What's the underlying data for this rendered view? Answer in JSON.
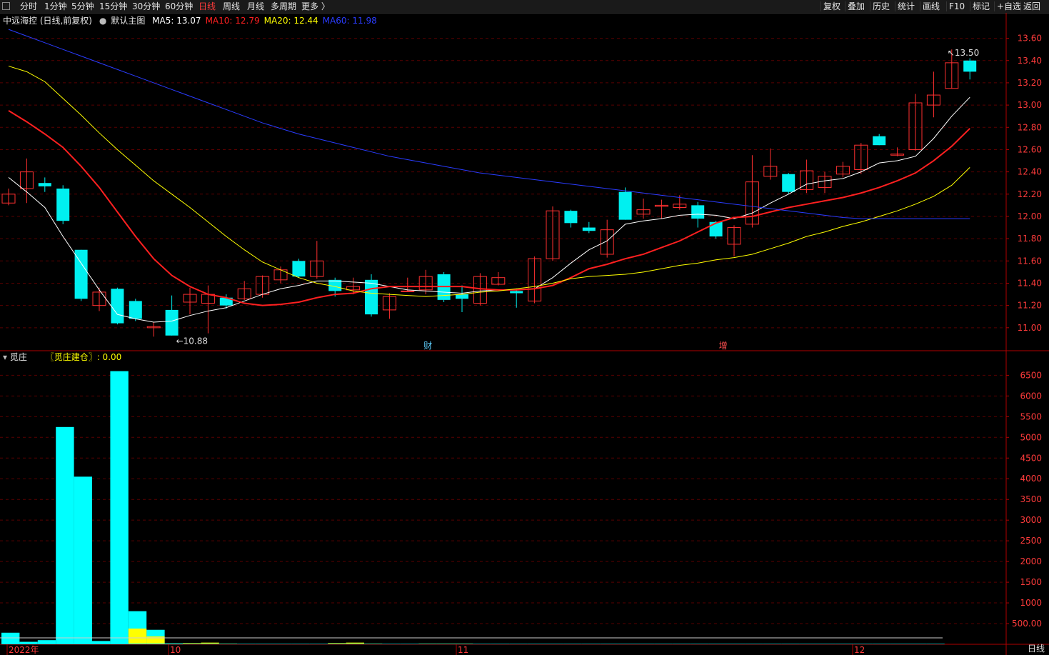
{
  "topbar": {
    "periods": [
      "分时",
      "1分钟",
      "5分钟",
      "15分钟",
      "30分钟",
      "60分钟",
      "日线",
      "周线",
      "月线",
      "多周期",
      "更多 〉"
    ],
    "active_period": "日线",
    "tools": [
      "复权",
      "叠加",
      "历史",
      "统计",
      "画线",
      "F10",
      "标记",
      "+自选",
      "返回"
    ]
  },
  "main_legend": {
    "stock_name": "中远海控 (日线,前复权)",
    "template": "默认主图",
    "ma": [
      {
        "label": "MA5: 13.07",
        "color": "#ffffff"
      },
      {
        "label": "MA10: 12.79",
        "color": "#ff2020"
      },
      {
        "label": "MA20: 12.44",
        "color": "#ffff00"
      },
      {
        "label": "MA60: 11.98",
        "color": "#2a3cff"
      }
    ]
  },
  "sub_legend": {
    "name": "觅庄",
    "indicator": "〖觅庄建仓〗: 0.00"
  },
  "markers": {
    "low_label": "10.88",
    "high_label": "13.50",
    "event_cai": "财",
    "event_zeng": "增"
  },
  "xaxis_labels": [
    {
      "label": "2022年",
      "color": "#ff3b3b"
    },
    {
      "label": "10",
      "color": "#ff3b3b"
    },
    {
      "label": "11",
      "color": "#ff3b3b"
    },
    {
      "label": "12",
      "color": "#ff3b3b"
    }
  ],
  "bottom_right_label": "日线",
  "colors": {
    "up": "#ff3030",
    "down": "#00f0f0",
    "grid": "#5a0000",
    "axis": "#b00000",
    "ma5": "#ffffff",
    "ma10": "#ff2020",
    "ma20": "#ffff00",
    "ma60": "#2a3cff",
    "vol_yellow": "#ffff00",
    "vol_cyan": "#00ffff"
  },
  "chart_data": [
    {
      "type": "candlestick",
      "title": "中远海控 (日线,前复权)",
      "ylim": [
        10.8,
        13.7
      ],
      "yticks": [
        "13.60",
        "13.40",
        "13.20",
        "13.00",
        "12.80",
        "12.60",
        "12.40",
        "12.20",
        "12.00",
        "11.80",
        "11.60",
        "11.40",
        "11.20",
        "11.00"
      ],
      "candles": [
        {
          "o": 12.12,
          "h": 12.25,
          "l": 12.1,
          "c": 12.2
        },
        {
          "o": 12.25,
          "h": 12.52,
          "l": 12.12,
          "c": 12.4
        },
        {
          "o": 12.3,
          "h": 12.35,
          "l": 12.22,
          "c": 12.27
        },
        {
          "o": 12.25,
          "h": 12.28,
          "l": 11.93,
          "c": 11.96
        },
        {
          "o": 11.7,
          "h": 11.7,
          "l": 11.24,
          "c": 11.26
        },
        {
          "o": 11.2,
          "h": 11.36,
          "l": 11.15,
          "c": 11.32
        },
        {
          "o": 11.35,
          "h": 11.36,
          "l": 11.03,
          "c": 11.04
        },
        {
          "o": 11.24,
          "h": 11.26,
          "l": 11.06,
          "c": 11.08
        },
        {
          "o": 11.0,
          "h": 11.05,
          "l": 10.92,
          "c": 11.01
        },
        {
          "o": 11.16,
          "h": 11.29,
          "l": 10.93,
          "c": 10.93
        },
        {
          "o": 11.23,
          "h": 11.36,
          "l": 11.12,
          "c": 11.3
        },
        {
          "o": 11.22,
          "h": 11.38,
          "l": 10.95,
          "c": 11.3
        },
        {
          "o": 11.27,
          "h": 11.3,
          "l": 11.17,
          "c": 11.2
        },
        {
          "o": 11.26,
          "h": 11.42,
          "l": 11.25,
          "c": 11.35
        },
        {
          "o": 11.3,
          "h": 11.47,
          "l": 11.27,
          "c": 11.46
        },
        {
          "o": 11.43,
          "h": 11.55,
          "l": 11.4,
          "c": 11.52
        },
        {
          "o": 11.6,
          "h": 11.62,
          "l": 11.45,
          "c": 11.46
        },
        {
          "o": 11.46,
          "h": 11.78,
          "l": 11.44,
          "c": 11.6
        },
        {
          "o": 11.43,
          "h": 11.45,
          "l": 11.28,
          "c": 11.33
        },
        {
          "o": 11.34,
          "h": 11.45,
          "l": 11.3,
          "c": 11.37
        },
        {
          "o": 11.43,
          "h": 11.48,
          "l": 11.1,
          "c": 11.12
        },
        {
          "o": 11.16,
          "h": 11.31,
          "l": 11.08,
          "c": 11.28
        },
        {
          "o": 11.33,
          "h": 11.45,
          "l": 11.32,
          "c": 11.33
        },
        {
          "o": 11.34,
          "h": 11.52,
          "l": 11.3,
          "c": 11.46
        },
        {
          "o": 11.48,
          "h": 11.5,
          "l": 11.23,
          "c": 11.25
        },
        {
          "o": 11.3,
          "h": 11.38,
          "l": 11.14,
          "c": 11.26
        },
        {
          "o": 11.22,
          "h": 11.49,
          "l": 11.2,
          "c": 11.46
        },
        {
          "o": 11.39,
          "h": 11.5,
          "l": 11.38,
          "c": 11.45
        },
        {
          "o": 11.33,
          "h": 11.35,
          "l": 11.18,
          "c": 11.31
        },
        {
          "o": 11.24,
          "h": 11.64,
          "l": 11.22,
          "c": 11.62
        },
        {
          "o": 11.62,
          "h": 12.09,
          "l": 11.6,
          "c": 12.05
        },
        {
          "o": 12.05,
          "h": 12.06,
          "l": 11.9,
          "c": 11.94
        },
        {
          "o": 11.9,
          "h": 11.95,
          "l": 11.85,
          "c": 11.87
        },
        {
          "o": 11.66,
          "h": 11.97,
          "l": 11.63,
          "c": 11.88
        },
        {
          "o": 12.22,
          "h": 12.26,
          "l": 11.97,
          "c": 11.97
        },
        {
          "o": 12.02,
          "h": 12.16,
          "l": 11.98,
          "c": 12.06
        },
        {
          "o": 12.09,
          "h": 12.15,
          "l": 11.98,
          "c": 12.1
        },
        {
          "o": 12.08,
          "h": 12.19,
          "l": 12.06,
          "c": 12.11
        },
        {
          "o": 12.1,
          "h": 12.13,
          "l": 11.9,
          "c": 11.98
        },
        {
          "o": 11.95,
          "h": 11.96,
          "l": 11.8,
          "c": 11.82
        },
        {
          "o": 11.75,
          "h": 11.92,
          "l": 11.64,
          "c": 11.9
        },
        {
          "o": 11.93,
          "h": 12.55,
          "l": 11.9,
          "c": 12.31
        },
        {
          "o": 12.36,
          "h": 12.61,
          "l": 12.33,
          "c": 12.45
        },
        {
          "o": 12.38,
          "h": 12.39,
          "l": 12.2,
          "c": 12.22
        },
        {
          "o": 12.24,
          "h": 12.51,
          "l": 12.21,
          "c": 12.41
        },
        {
          "o": 12.26,
          "h": 12.4,
          "l": 12.21,
          "c": 12.36
        },
        {
          "o": 12.38,
          "h": 12.49,
          "l": 12.35,
          "c": 12.45
        },
        {
          "o": 12.42,
          "h": 12.66,
          "l": 12.38,
          "c": 12.64
        },
        {
          "o": 12.72,
          "h": 12.74,
          "l": 12.64,
          "c": 12.64
        },
        {
          "o": 12.55,
          "h": 12.62,
          "l": 12.54,
          "c": 12.56
        },
        {
          "o": 12.6,
          "h": 13.1,
          "l": 12.59,
          "c": 13.02
        },
        {
          "o": 13.0,
          "h": 13.3,
          "l": 12.89,
          "c": 13.09
        },
        {
          "o": 13.15,
          "h": 13.5,
          "l": 13.15,
          "c": 13.38
        },
        {
          "o": 13.4,
          "h": 13.42,
          "l": 13.23,
          "c": 13.3
        }
      ],
      "series": [
        {
          "name": "MA5",
          "values": [
            12.35,
            12.22,
            12.08,
            11.82,
            11.58,
            11.34,
            11.12,
            11.08,
            11.05,
            11.06,
            11.11,
            11.15,
            11.18,
            11.24,
            11.3,
            11.35,
            11.38,
            11.42,
            11.42,
            11.41,
            11.4,
            11.37,
            11.34,
            11.33,
            11.32,
            11.31,
            11.33,
            11.34,
            11.34,
            11.35,
            11.45,
            11.58,
            11.7,
            11.78,
            11.93,
            11.96,
            11.98,
            12.01,
            12.02,
            12.01,
            11.98,
            12.03,
            12.12,
            12.2,
            12.29,
            12.32,
            12.34,
            12.4,
            12.48,
            12.5,
            12.54,
            12.7,
            12.9,
            13.07
          ]
        },
        {
          "name": "MA10",
          "values": [
            12.95,
            12.85,
            12.74,
            12.62,
            12.45,
            12.26,
            12.04,
            11.82,
            11.62,
            11.47,
            11.37,
            11.3,
            11.27,
            11.22,
            11.2,
            11.21,
            11.23,
            11.27,
            11.3,
            11.31,
            11.35,
            11.37,
            11.37,
            11.37,
            11.37,
            11.37,
            11.35,
            11.34,
            11.34,
            11.35,
            11.38,
            11.45,
            11.53,
            11.57,
            11.62,
            11.66,
            11.72,
            11.78,
            11.86,
            11.94,
            11.99,
            12.0,
            12.04,
            12.08,
            12.11,
            12.14,
            12.17,
            12.21,
            12.26,
            12.32,
            12.39,
            12.5,
            12.63,
            12.79
          ]
        },
        {
          "name": "MA20",
          "values": [
            13.35,
            13.3,
            13.21,
            13.06,
            12.91,
            12.75,
            12.6,
            12.46,
            12.32,
            12.2,
            12.08,
            11.95,
            11.82,
            11.7,
            11.59,
            11.52,
            11.45,
            11.4,
            11.37,
            11.33,
            11.31,
            11.3,
            11.29,
            11.28,
            11.29,
            11.3,
            11.32,
            11.33,
            11.35,
            11.37,
            11.4,
            11.44,
            11.46,
            11.47,
            11.48,
            11.5,
            11.53,
            11.56,
            11.58,
            11.61,
            11.63,
            11.66,
            11.71,
            11.76,
            11.82,
            11.86,
            11.91,
            11.95,
            12.0,
            12.05,
            12.11,
            12.18,
            12.28,
            12.44
          ]
        },
        {
          "name": "MA60",
          "values": [
            13.68,
            13.62,
            13.56,
            13.5,
            13.44,
            13.38,
            13.32,
            13.26,
            13.2,
            13.14,
            13.08,
            13.02,
            12.96,
            12.9,
            12.84,
            12.79,
            12.74,
            12.7,
            12.66,
            12.62,
            12.58,
            12.54,
            12.51,
            12.48,
            12.45,
            12.42,
            12.39,
            12.37,
            12.35,
            12.33,
            12.31,
            12.29,
            12.27,
            12.25,
            12.23,
            12.21,
            12.19,
            12.17,
            12.15,
            12.13,
            12.11,
            12.09,
            12.07,
            12.05,
            12.03,
            12.01,
            11.99,
            11.98,
            11.98,
            11.98,
            11.98,
            11.98,
            11.98,
            11.98
          ]
        }
      ]
    },
    {
      "type": "bar",
      "title": "觅庄",
      "ylim": [
        0,
        6800
      ],
      "yticks": [
        "6500",
        "6000",
        "5500",
        "5000",
        "4500",
        "4000",
        "3500",
        "3000",
        "2500",
        "2000",
        "1500",
        "1000",
        "500.00"
      ],
      "series": [
        {
          "name": "cyan",
          "values": [
            280,
            60,
            100,
            5250,
            4050,
            80,
            6600,
            800,
            350,
            20,
            10,
            10,
            10,
            10,
            10,
            10,
            10,
            10,
            10,
            10,
            10,
            10,
            10,
            10,
            10,
            10,
            10,
            10,
            10,
            10,
            10,
            10,
            10,
            10,
            10,
            10,
            10,
            10,
            10,
            10,
            10,
            10,
            10,
            10,
            10,
            10,
            10,
            10,
            10,
            10,
            10,
            10
          ]
        },
        {
          "name": "yellow",
          "values": [
            0,
            0,
            0,
            0,
            0,
            0,
            0,
            380,
            190,
            20,
            30,
            40,
            20,
            0,
            0,
            0,
            0,
            0,
            30,
            40,
            20,
            0,
            0,
            20,
            20,
            20,
            0,
            0,
            0,
            0,
            0,
            0,
            0,
            0,
            0,
            0,
            0,
            0,
            0,
            0,
            0,
            0,
            0,
            0,
            0,
            0,
            0,
            0,
            0,
            0,
            0,
            0
          ]
        }
      ]
    }
  ]
}
